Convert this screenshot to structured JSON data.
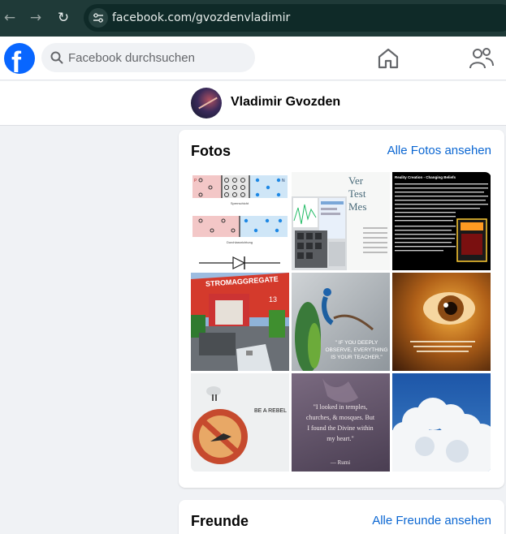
{
  "browser": {
    "url": "facebook.com/gvozdenvladimir",
    "back_icon": "←",
    "forward_icon": "→",
    "reload_icon": "↻"
  },
  "fb": {
    "logo_letter": "f",
    "search_placeholder": "Facebook durchsuchen"
  },
  "profile": {
    "name": "Vladimir Gvozden"
  },
  "photos": {
    "title": "Fotos",
    "link": "Alle Fotos ansehen",
    "tiles": [
      {
        "texts": [
          "Sperrschicht",
          "Durchlassrichtung",
          "P",
          "N"
        ]
      },
      {
        "texts": [
          "Ver",
          "Test",
          "Mes"
        ]
      },
      {
        "texts": [
          "Reality Creation - Changing Beliefs"
        ]
      },
      {
        "texts": [
          "STROMAGGREGATE",
          "13"
        ]
      },
      {
        "texts": [
          "\" IF YOU DEEPLY",
          "OBSERVE, EVERYTHING",
          "IS YOUR TEACHER.\""
        ]
      },
      {
        "texts": []
      },
      {
        "texts": [
          "BE A REBEL"
        ]
      },
      {
        "texts": [
          "\"I looked in temples,",
          "churches, & mosques. But",
          "I found the Divine within",
          "my heart.\"",
          "— Rumi"
        ]
      },
      {
        "texts": []
      }
    ]
  },
  "friends": {
    "title": "Freunde",
    "link": "Alle Freunde ansehen"
  },
  "colors": {
    "fb_blue": "#0866ff",
    "link_blue": "#0a66d2",
    "chrome_bg": "#1f3a38"
  }
}
